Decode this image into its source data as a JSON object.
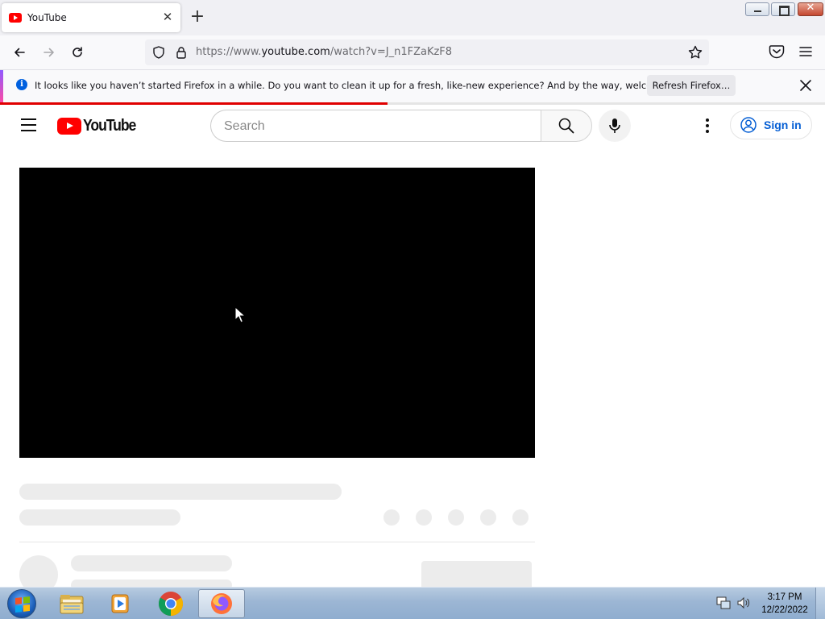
{
  "browser": {
    "tab": {
      "title": "YouTube",
      "close_glyph": "✕"
    },
    "new_tab_glyph": "+",
    "window_controls": {
      "close_glyph": "✕"
    },
    "url": {
      "prefix": "https://www.",
      "domain": "youtube.com",
      "path": "/watch?v=J_n1FZaKzF8"
    },
    "notification": {
      "message": "It looks like you haven’t started Firefox in a while. Do you want to clean it up for a fresh, like-new experience? And by the way, welcome back!",
      "button": "Refresh Firefox…",
      "info_glyph": "i"
    },
    "page_load_progress": 0.47
  },
  "youtube": {
    "logo_text": "YouTube",
    "search_placeholder": "Search",
    "sign_in_label": "Sign in",
    "brand_color": "#ff0000",
    "link_color": "#065fd4"
  },
  "player": {
    "background": "#000000"
  },
  "skeleton": {
    "color": "#ececec",
    "action_dots": 5
  },
  "taskbar": {
    "apps": [
      "explorer",
      "media-player",
      "chrome",
      "firefox"
    ],
    "active_app": "firefox",
    "clock_time": "3:17 PM",
    "clock_date": "12/22/2022"
  },
  "icons": [
    "youtube-favicon",
    "back-arrow-icon",
    "forward-arrow-icon",
    "reload-icon",
    "shield-icon",
    "lock-icon",
    "star-icon",
    "pocket-icon",
    "menu-icon",
    "info-icon",
    "close-icon",
    "hamburger-icon",
    "search-icon",
    "microphone-icon",
    "more-vert-icon",
    "account-circle-icon",
    "windows-logo-icon",
    "folder-icon",
    "media-player-icon",
    "chrome-icon",
    "firefox-icon",
    "network-icon",
    "volume-icon",
    "mouse-pointer-icon"
  ]
}
